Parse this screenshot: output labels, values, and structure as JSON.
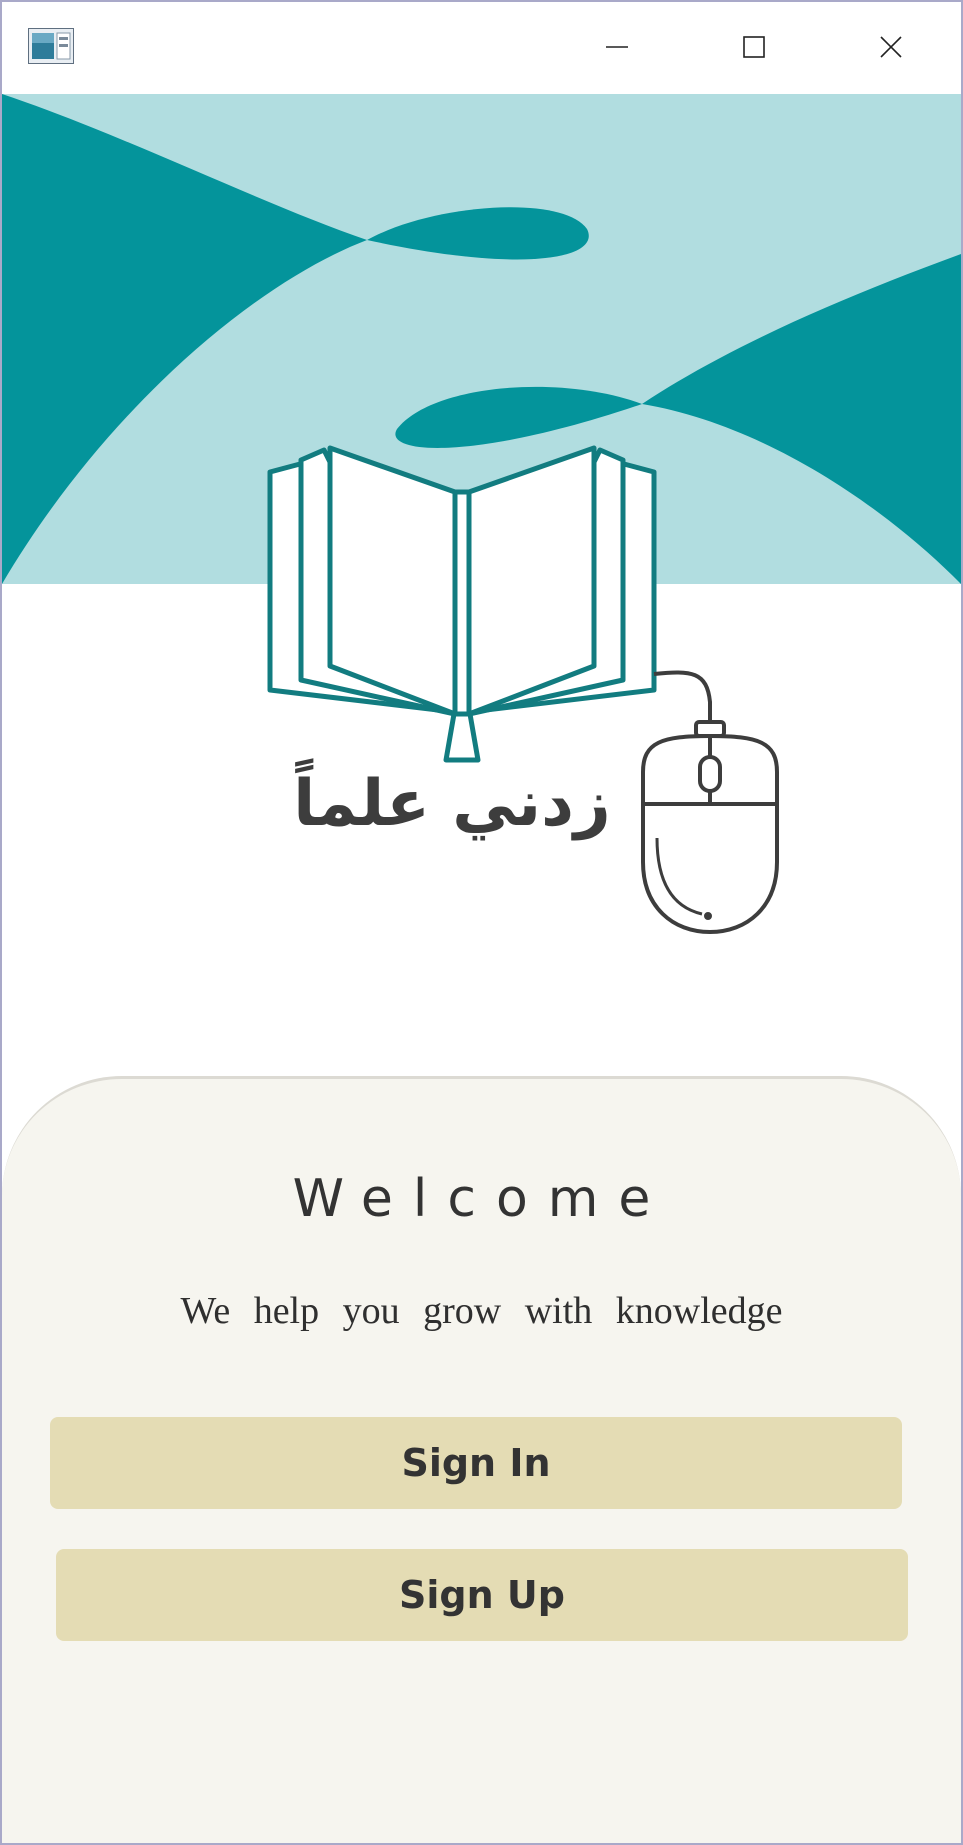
{
  "window": {
    "icons": {
      "app": "app-window-icon",
      "minimize": "minimize-icon",
      "maximize": "maximize-icon",
      "close": "close-icon"
    }
  },
  "brand": {
    "name_ar": "زدني علماً",
    "colors": {
      "teal_dark": "#04949b",
      "teal_light": "#b1dde0",
      "logo_stroke": "#127c80",
      "text_dark": "#3d3d3d"
    },
    "icons": [
      "open-book-icon",
      "computer-mouse-icon"
    ]
  },
  "panel": {
    "welcome": "Welcome",
    "tagline": "We help you grow with knowledge",
    "background": "#f6f5ef"
  },
  "actions": {
    "sign_in": "Sign In",
    "sign_up": "Sign Up",
    "button_color": "#e4dcb4"
  }
}
